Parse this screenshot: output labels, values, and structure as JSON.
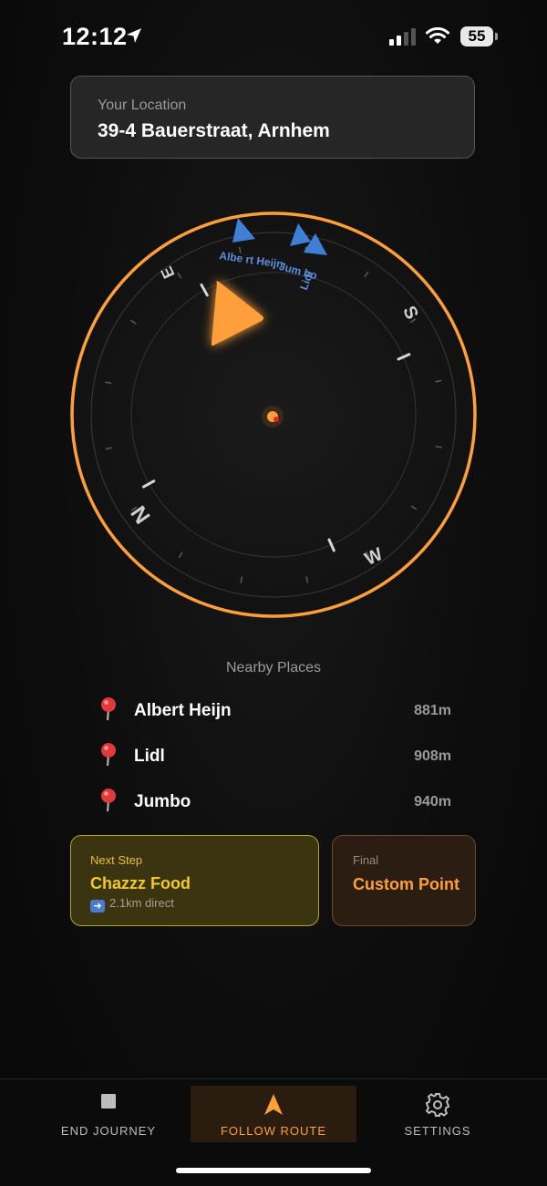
{
  "status_bar": {
    "time": "12:12",
    "battery": "55",
    "icons": [
      "location-arrow-icon",
      "signal-icon",
      "wifi-icon",
      "battery-icon"
    ]
  },
  "location": {
    "label": "Your Location",
    "address": "39-4 Bauerstraat, Arnhem"
  },
  "compass": {
    "cardinals": {
      "north": "N",
      "east": "E",
      "south": "S",
      "west": "W"
    },
    "markers": [
      {
        "label": "Albe rt Heijn",
        "color": "#3f7fd6"
      },
      {
        "label": "Jum bo",
        "color": "#3f7fd6"
      },
      {
        "label": "Lidl",
        "color": "#3f7fd6"
      }
    ],
    "heading_color": "#ff9f3a",
    "center_color": "#ff9f3a"
  },
  "nearby": {
    "title": "Nearby Places",
    "places": [
      {
        "name": "Albert Heijn",
        "distance": "881m"
      },
      {
        "name": "Lidl",
        "distance": "908m"
      },
      {
        "name": "Jumbo",
        "distance": "940m"
      }
    ]
  },
  "next_step": {
    "label": "Next Step",
    "title": "Chazzz Food",
    "arrow_icon": "arrow-right-icon",
    "subtitle": "2.1km direct"
  },
  "final": {
    "label": "Final",
    "title": "Custom Point"
  },
  "tabs": {
    "end": {
      "label": "END JOURNEY",
      "icon": "stop-icon"
    },
    "follow": {
      "label": "FOLLOW ROUTE",
      "icon": "navigation-arrow-icon"
    },
    "settings": {
      "label": "SETTINGS",
      "icon": "gear-icon"
    }
  },
  "colors": {
    "accent": "#ff9f3a",
    "next_step": "#f5c925",
    "marker": "#3f7fd6"
  }
}
